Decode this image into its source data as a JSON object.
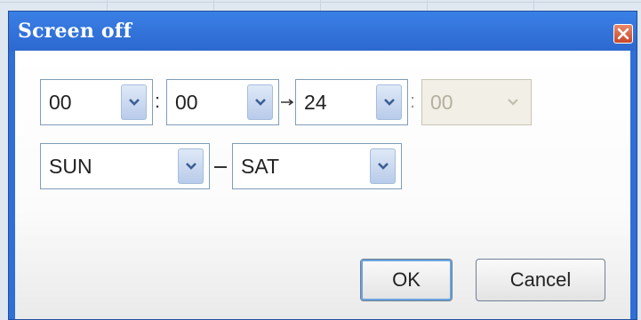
{
  "dialog": {
    "title": "Screen off",
    "close_icon": "close-icon"
  },
  "time": {
    "start_hour": "00",
    "start_minute": "00",
    "end_hour": "24",
    "end_minute": "00",
    "separator": ":",
    "end_minute_disabled": true
  },
  "days": {
    "start_day": "SUN",
    "end_day": "SAT"
  },
  "buttons": {
    "ok_label": "OK",
    "cancel_label": "Cancel"
  },
  "colors": {
    "titlebar": "#2f6fd6",
    "close_button": "#c8462a",
    "combo_border": "#7f9db9"
  }
}
